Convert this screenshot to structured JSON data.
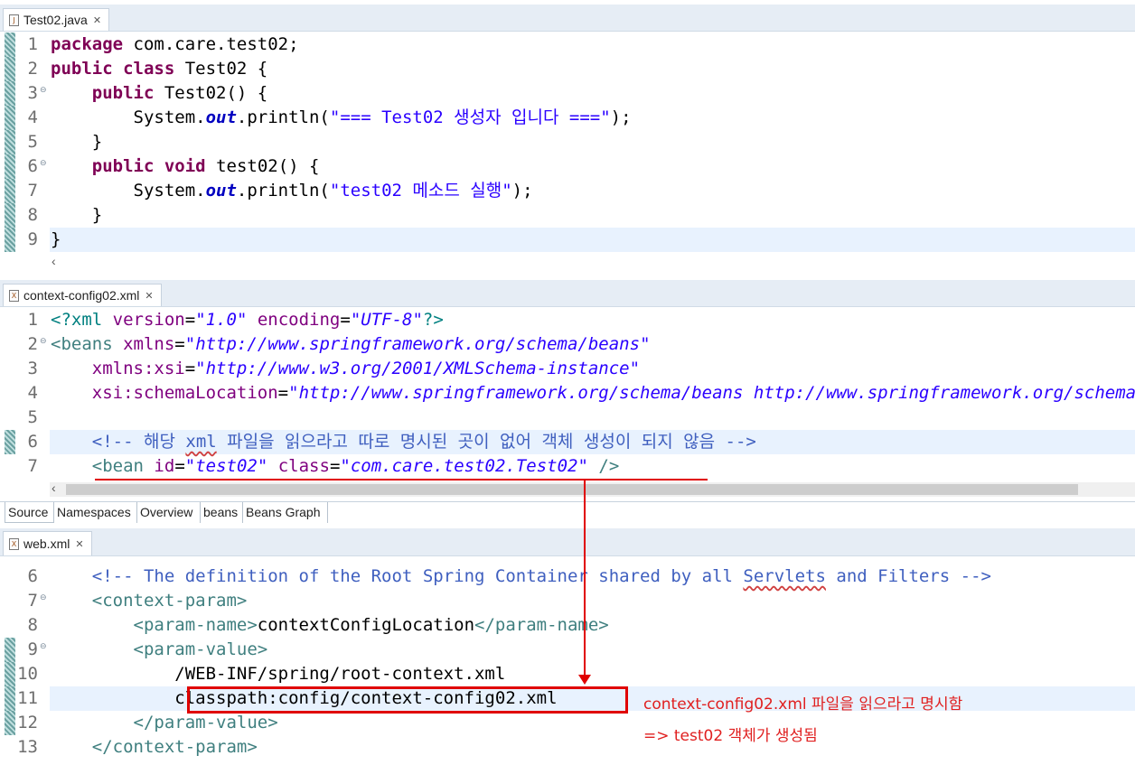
{
  "editor1": {
    "tab": "Test02.java",
    "lines": [
      {
        "n": "1",
        "fold": false,
        "ruler": true,
        "hl": false,
        "segs": [
          {
            "c": "kw",
            "t": "package"
          },
          {
            "c": "",
            "t": " com.care.test02;"
          }
        ]
      },
      {
        "n": "2",
        "fold": false,
        "ruler": true,
        "hl": false,
        "segs": [
          {
            "c": "kw",
            "t": "public"
          },
          {
            "c": "",
            "t": " "
          },
          {
            "c": "kw",
            "t": "class"
          },
          {
            "c": "",
            "t": " Test02 {"
          }
        ]
      },
      {
        "n": "3",
        "fold": true,
        "ruler": true,
        "hl": false,
        "segs": [
          {
            "c": "",
            "t": "    "
          },
          {
            "c": "kw",
            "t": "public"
          },
          {
            "c": "",
            "t": " Test02() {"
          }
        ]
      },
      {
        "n": "4",
        "fold": false,
        "ruler": true,
        "hl": false,
        "segs": [
          {
            "c": "",
            "t": "        System."
          },
          {
            "c": "fld",
            "t": "out"
          },
          {
            "c": "",
            "t": ".println("
          },
          {
            "c": "str",
            "t": "\"=== Test02 생성자 입니다 ===\""
          },
          {
            "c": "",
            "t": ");"
          }
        ]
      },
      {
        "n": "5",
        "fold": false,
        "ruler": true,
        "hl": false,
        "segs": [
          {
            "c": "",
            "t": "    }"
          }
        ]
      },
      {
        "n": "6",
        "fold": true,
        "ruler": true,
        "hl": false,
        "segs": [
          {
            "c": "",
            "t": "    "
          },
          {
            "c": "kw",
            "t": "public"
          },
          {
            "c": "",
            "t": " "
          },
          {
            "c": "kw",
            "t": "void"
          },
          {
            "c": "",
            "t": " test02() {"
          }
        ]
      },
      {
        "n": "7",
        "fold": false,
        "ruler": true,
        "hl": false,
        "segs": [
          {
            "c": "",
            "t": "        System."
          },
          {
            "c": "fld",
            "t": "out"
          },
          {
            "c": "",
            "t": ".println("
          },
          {
            "c": "str",
            "t": "\"test02 메소드 실행\""
          },
          {
            "c": "",
            "t": ");"
          }
        ]
      },
      {
        "n": "8",
        "fold": false,
        "ruler": true,
        "hl": false,
        "segs": [
          {
            "c": "",
            "t": "    }"
          }
        ]
      },
      {
        "n": "9",
        "fold": false,
        "ruler": true,
        "hl": true,
        "segs": [
          {
            "c": "",
            "t": "}"
          }
        ]
      }
    ]
  },
  "editor2": {
    "tab": "context-config02.xml",
    "lines": [
      {
        "n": "1",
        "fold": false,
        "ruler": false,
        "hl": false,
        "segs": [
          {
            "c": "pi",
            "t": "<?xml"
          },
          {
            "c": "",
            "t": " "
          },
          {
            "c": "attr",
            "t": "version"
          },
          {
            "c": "",
            "t": "="
          },
          {
            "c": "val",
            "t": "\"1.0\""
          },
          {
            "c": "",
            "t": " "
          },
          {
            "c": "attr",
            "t": "encoding"
          },
          {
            "c": "",
            "t": "="
          },
          {
            "c": "val",
            "t": "\"UTF-8\""
          },
          {
            "c": "pi",
            "t": "?>"
          }
        ]
      },
      {
        "n": "2",
        "fold": true,
        "ruler": false,
        "hl": false,
        "segs": [
          {
            "c": "tag",
            "t": "<beans"
          },
          {
            "c": "",
            "t": " "
          },
          {
            "c": "attr",
            "t": "xmlns"
          },
          {
            "c": "",
            "t": "="
          },
          {
            "c": "val",
            "t": "\"http://www.springframework.org/schema/beans\""
          }
        ]
      },
      {
        "n": "3",
        "fold": false,
        "ruler": false,
        "hl": false,
        "segs": [
          {
            "c": "",
            "t": "    "
          },
          {
            "c": "attr",
            "t": "xmlns:xsi"
          },
          {
            "c": "",
            "t": "="
          },
          {
            "c": "val",
            "t": "\"http://www.w3.org/2001/XMLSchema-instance\""
          }
        ]
      },
      {
        "n": "4",
        "fold": false,
        "ruler": false,
        "hl": false,
        "segs": [
          {
            "c": "",
            "t": "    "
          },
          {
            "c": "attr",
            "t": "xsi:schemaLocation"
          },
          {
            "c": "",
            "t": "="
          },
          {
            "c": "val",
            "t": "\"http://www.springframework.org/schema/beans http://www.springframework.org/schema/beans/spring-beans.xsd\""
          }
        ]
      },
      {
        "n": "5",
        "fold": false,
        "ruler": false,
        "hl": false,
        "segs": []
      },
      {
        "n": "6",
        "fold": false,
        "ruler": true,
        "hl": true,
        "segs": [
          {
            "c": "",
            "t": "    "
          },
          {
            "c": "cmt",
            "t": "<!-- 해당 "
          },
          {
            "c": "cmt sq",
            "t": "xml"
          },
          {
            "c": "cmt",
            "t": " 파일을 읽으라고 따로 명시된 곳이 없어 객체 생성이 되지 않음 -->"
          }
        ]
      },
      {
        "n": "7",
        "fold": false,
        "ruler": false,
        "hl": false,
        "segs": [
          {
            "c": "",
            "t": "    "
          },
          {
            "c": "tag",
            "t": "<bean"
          },
          {
            "c": "",
            "t": " "
          },
          {
            "c": "attr",
            "t": "id"
          },
          {
            "c": "",
            "t": "="
          },
          {
            "c": "val",
            "t": "\"test02\""
          },
          {
            "c": "",
            "t": " "
          },
          {
            "c": "attr",
            "t": "class"
          },
          {
            "c": "",
            "t": "="
          },
          {
            "c": "val",
            "t": "\"com.care.test02.Test02\""
          },
          {
            "c": "",
            "t": " "
          },
          {
            "c": "tag",
            "t": "/>"
          }
        ]
      }
    ],
    "page_tabs": [
      "Source",
      "Namespaces",
      "Overview",
      "beans",
      "Beans Graph"
    ]
  },
  "editor3": {
    "tab": "web.xml",
    "lines": [
      {
        "n": "6",
        "fold": false,
        "ruler": false,
        "hl": false,
        "segs": [
          {
            "c": "",
            "t": "    "
          },
          {
            "c": "cmt",
            "t": "<!-- The definition of the Root Spring Container shared by all "
          },
          {
            "c": "cmt sq",
            "t": "Servlets"
          },
          {
            "c": "cmt",
            "t": " and Filters -->"
          }
        ]
      },
      {
        "n": "7",
        "fold": true,
        "ruler": false,
        "hl": false,
        "segs": [
          {
            "c": "",
            "t": "    "
          },
          {
            "c": "tag",
            "t": "<context-param>"
          }
        ]
      },
      {
        "n": "8",
        "fold": false,
        "ruler": false,
        "hl": false,
        "segs": [
          {
            "c": "",
            "t": "        "
          },
          {
            "c": "tag",
            "t": "<param-name>"
          },
          {
            "c": "",
            "t": "contextConfigLocation"
          },
          {
            "c": "tag",
            "t": "</param-name>"
          }
        ]
      },
      {
        "n": "9",
        "fold": true,
        "ruler": true,
        "hl": false,
        "segs": [
          {
            "c": "",
            "t": "        "
          },
          {
            "c": "tag",
            "t": "<param-value>"
          }
        ]
      },
      {
        "n": "10",
        "fold": false,
        "ruler": true,
        "hl": false,
        "segs": [
          {
            "c": "",
            "t": "            /WEB-INF/spring/root-context.xml"
          }
        ]
      },
      {
        "n": "11",
        "fold": false,
        "ruler": true,
        "hl": true,
        "segs": [
          {
            "c": "",
            "t": "            classpath:config/context-config02.xml"
          }
        ]
      },
      {
        "n": "12",
        "fold": false,
        "ruler": true,
        "hl": false,
        "segs": [
          {
            "c": "",
            "t": "        "
          },
          {
            "c": "tag",
            "t": "</param-value>"
          }
        ]
      },
      {
        "n": "13",
        "fold": false,
        "ruler": false,
        "hl": false,
        "segs": [
          {
            "c": "",
            "t": "    "
          },
          {
            "c": "tag",
            "t": "</context-param>"
          }
        ]
      }
    ]
  },
  "annotations": {
    "note1": "context-config02.xml 파일을 읽으라고 명시함",
    "note2": "=> test02 객체가 생성됨",
    "color": "#e00000"
  }
}
